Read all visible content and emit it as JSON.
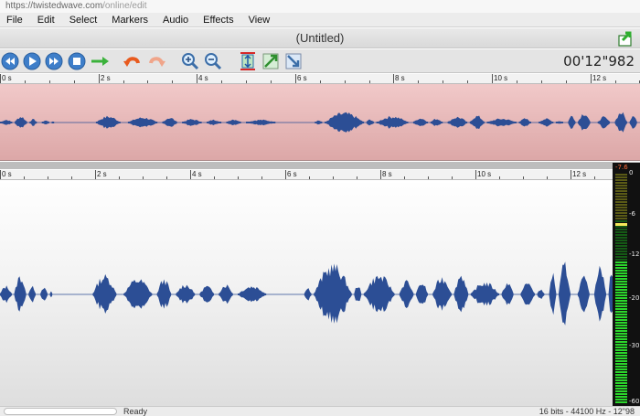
{
  "browser": {
    "url_host": "https://twistedwave.com",
    "url_path": "/online/edit"
  },
  "menu": [
    "File",
    "Edit",
    "Select",
    "Markers",
    "Audio",
    "Effects",
    "View"
  ],
  "document": {
    "title": "(Untitled)"
  },
  "toolbar": {
    "buttons": [
      "rewind",
      "play",
      "fast-forward",
      "stop",
      "go-to-cursor",
      "undo",
      "redo",
      "zoom-in",
      "zoom-out",
      "zoom-fit",
      "zoom-selection",
      "zoom-out-full"
    ],
    "time_readout": "00'12\"982"
  },
  "overview_ruler": [
    "0 s",
    "2 s",
    "4 s",
    "6 s",
    "8 s",
    "10 s",
    "12 s"
  ],
  "main_ruler": [
    "0 s",
    "2 s",
    "4 s",
    "6 s",
    "8 s",
    "10 s",
    "12 s"
  ],
  "meter": {
    "peak": "-7.6",
    "labels": [
      "0",
      "-6",
      "-12",
      "-20",
      "-30",
      "-60"
    ],
    "level_fraction": 0.62
  },
  "status": {
    "text": "Ready",
    "info": "16 bits - 44100 Hz - 12\"98",
    "progress_fraction": 0
  },
  "colors": {
    "wave": "#2c4e95",
    "overview_bg": "#e8b8b8",
    "meter_green": "#2bd62b"
  }
}
